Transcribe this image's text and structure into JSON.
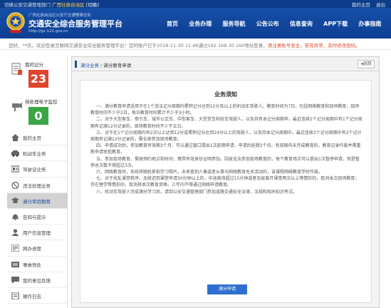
{
  "topbar": {
    "dept_prefix": "切换公安交通管理部门",
    "dept_name": "广西壮族自治区",
    "switch_label": "[切换]",
    "user_home": "我的主页",
    "logout": "退出"
  },
  "header": {
    "subtitle": "广西壮族自治区公安厅交通警察总队",
    "title": "交通安全综合服务管理平台",
    "url": "http://gx.122.gov.cn",
    "nav": [
      "首页",
      "业务办理",
      "服务导航",
      "公告公布",
      "信息查询",
      "APP下载",
      "办事指南"
    ]
  },
  "notice_line": {
    "greeting": "您好，**庆。欢迎登录互联网交通安全综合服务管理平台！您的账户已于2018-11-30 11:46通过192.168.30.160地址登录，",
    "alert": "请注意账号安全，若有异常，及时修改密码。"
  },
  "sidebar": {
    "score_label": "我的记分",
    "score_value": "23",
    "ecap_label": "待处理电子监控",
    "ecap_value": "0",
    "menu": [
      {
        "label": "我的主页",
        "icon": "home-icon"
      },
      {
        "label": "机动车业务",
        "icon": "car-icon"
      },
      {
        "label": "驾驶证业务",
        "icon": "license-icon"
      },
      {
        "label": "违法处理业务",
        "icon": "violation-icon"
      },
      {
        "label": "满分审验教育",
        "icon": "education-icon",
        "active": true
      },
      {
        "label": "告知与提示",
        "icon": "bell-icon"
      },
      {
        "label": "用户信息管理",
        "icon": "user-icon"
      },
      {
        "label": "网办进度",
        "icon": "progress-icon"
      },
      {
        "label": "事故快处",
        "icon": "accident-icon"
      },
      {
        "label": "我的意见反馈",
        "icon": "feedback-icon"
      },
      {
        "label": "操作日志",
        "icon": "log-icon"
      }
    ]
  },
  "content": {
    "breadcrumb_root": "满分业务",
    "breadcrumb_separator": "/",
    "breadcrumb_current": "满分教育申请",
    "back_label": "返回",
    "notice_title": "业务须知",
    "paragraphs": [
      "一、满分教育申请适用于在1个违法记分周期内累积记分达到12分及以上的机动车驾驶人。教育时间为7日，包括网络教育和现场教育，现场教育时间不少于2日，每日教育时间累计不少于3小时。",
      "二、对于大型客车、牵引车、城市公交车、中型客车、大型货车和校车驾驶人，以及持有本记分周期申，最近连续2个记分周期中有1个记分周期有记满12分记录的，现场教育时间不少于五日。",
      "三、对于在1个记分周期内有2次以上达到12分或累积记分达到24分以上的驾驶人，以及持本记分周期中，最近连续3个记分周期中有2个记分周期有记满12分记录的，需全部参加现场教育。",
      "四、申请成功后，参加教育有效期3个月，可以通过窗口提出1次延期申请，申请后延期3个月。有效期内未完成教育的，教育记录作废并需重新申请审批教育。",
      "五、参加现场教育，需按预约地点和时间，携带有效身份证明参加。因故无法参加现场教育的，每个教育场次可以提出1次暂停申请，但是暂停总次数不得超过3次。",
      "六、网络教育时，系统将随机抓拍学习照片，未来查到人像或者从事与网络教育无关活动的，该课程网络教育学时作废。",
      "七、对于扰乱课堂秩序、无故迟到课堂申请30分钟以上的，中途离场超过15分钟或者无故离开课堂两次以上等情形的，取消本次现场教育；存在替学等情形的，取消其本次教育资格，三年内不得通过网络申请教育。",
      "八、机动车驾驶人完成满分学习后，请到公安交通管理部门参加道路交通安全法律、法规和相关知识考试。"
    ],
    "apply_label": "满分申请"
  },
  "colors": {
    "brand_blue": "#1a4ea0",
    "score_red": "#e0452f",
    "ecap_green": "#3aa644",
    "apply_blue": "#2f6fcf"
  }
}
